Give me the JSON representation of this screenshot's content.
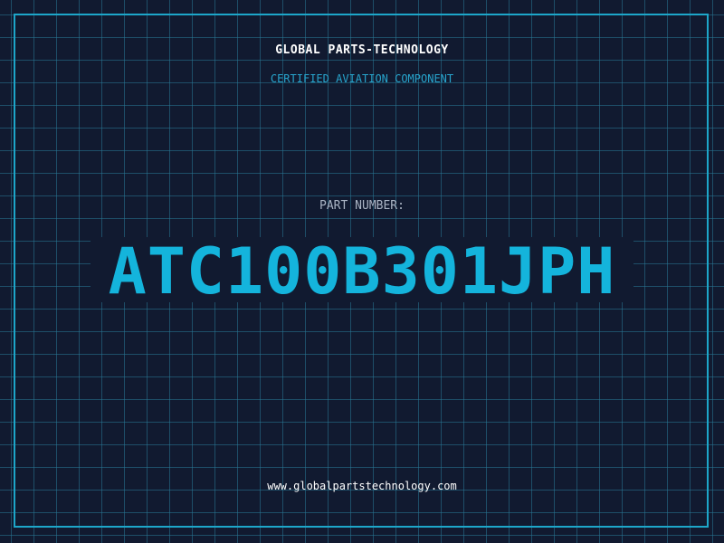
{
  "header": {
    "company": "GLOBAL PARTS-TECHNOLOGY",
    "subtitle": "CERTIFIED AVIATION COMPONENT"
  },
  "part": {
    "label": "PART NUMBER:",
    "number": "ATC100B301JPH"
  },
  "footer": {
    "website": "www.globalpartstechnology.com"
  },
  "colors": {
    "background": "#111a30",
    "grid": "#287896",
    "accent": "#14b4dc",
    "frame": "#1da6c9"
  }
}
